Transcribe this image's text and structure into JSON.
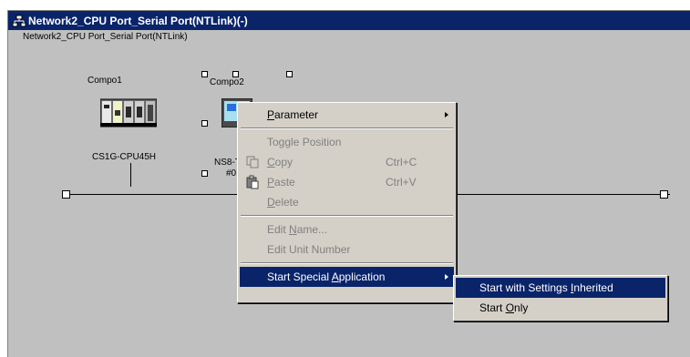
{
  "window": {
    "title": "Network2_CPU Port_Serial Port(NTLink)(-)"
  },
  "canvas": {
    "network_label": "Network2_CPU Port_Serial Port(NTLink)",
    "components": [
      {
        "name": "Compo1",
        "model": "CS1G-CPU45H"
      },
      {
        "name": "Compo2",
        "model": "NS8-T",
        "address": "#0"
      }
    ]
  },
  "context_menu": {
    "items": [
      {
        "label": "Parameter",
        "underline": "P",
        "rest": "arameter",
        "enabled": true,
        "submenu": true
      },
      {
        "label": "Toggle Position",
        "enabled": false
      },
      {
        "label": "Copy",
        "underline": "C",
        "rest": "opy",
        "shortcut": "Ctrl+C",
        "enabled": false,
        "icon": "copy-icon"
      },
      {
        "label": "Paste",
        "underline": "P",
        "rest": "aste",
        "shortcut": "Ctrl+V",
        "enabled": false,
        "icon": "paste-icon"
      },
      {
        "label": "Delete",
        "underline": "D",
        "rest": "elete",
        "enabled": false
      },
      {
        "label": "Edit Name...",
        "before": "Edit ",
        "underline": "N",
        "rest": "ame...",
        "enabled": false
      },
      {
        "label": "Edit Unit Number",
        "enabled": false
      },
      {
        "label": "Start Special Application",
        "before": "Start Special ",
        "underline": "A",
        "rest": "pplication",
        "enabled": true,
        "submenu": true,
        "selected": true
      }
    ]
  },
  "submenu": {
    "items": [
      {
        "label": "Start with Settings Inherited",
        "before": "Start with Settings ",
        "underline": "I",
        "rest": "nherited",
        "selected": true
      },
      {
        "label": "Start Only",
        "before": "Start ",
        "underline": "O",
        "rest": "nly",
        "selected": false
      }
    ]
  },
  "colors": {
    "titlebar": "#0a246a",
    "menu_bg": "#d4d0c8",
    "canvas_bg": "#c0c0c0",
    "highlight": "#0a246a"
  }
}
